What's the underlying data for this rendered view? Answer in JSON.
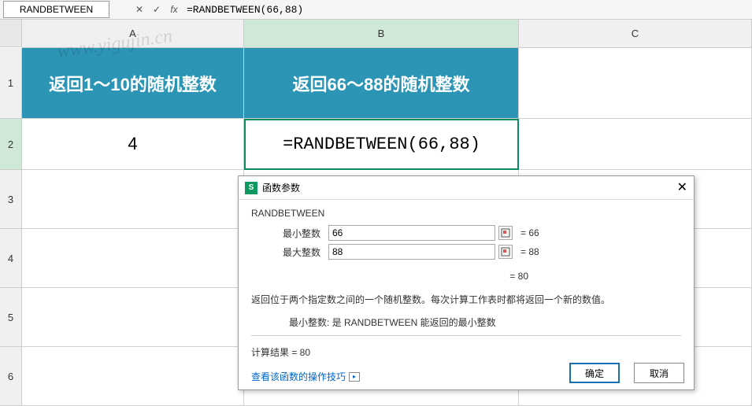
{
  "formulaBar": {
    "nameBox": "RANDBETWEEN",
    "fx": "fx",
    "formula": "=RANDBETWEEN(66,88)"
  },
  "columns": {
    "A": "A",
    "B": "B",
    "C": "C"
  },
  "rows": {
    "1": "1",
    "2": "2",
    "3": "3",
    "4": "4",
    "5": "5",
    "6": "6"
  },
  "cells": {
    "A1": "返回1～10的随机整数",
    "B1": "返回66～88的随机整数",
    "A2": "4",
    "B2": "=RANDBETWEEN(66,88)"
  },
  "dialog": {
    "title": "函数参数",
    "fnName": "RANDBETWEEN",
    "params": {
      "minLabel": "最小整数",
      "minValue": "66",
      "minEq": "= 66",
      "maxLabel": "最大整数",
      "maxValue": "88",
      "maxEq": "= 88"
    },
    "resultEq": "= 80",
    "desc": "返回位于两个指定数之间的一个随机整数。每次计算工作表时都将返回一个新的数值。",
    "descSub": "最小整数:   是 RANDBETWEEN 能返回的最小整数",
    "calcResult": "计算结果 =  80",
    "link": "查看该函数的操作技巧",
    "okBtn": "确定",
    "cancelBtn": "取消"
  },
  "watermarks": {
    "w1": "www.yigujin.cn",
    "w2": "www.yigujin.cn"
  }
}
